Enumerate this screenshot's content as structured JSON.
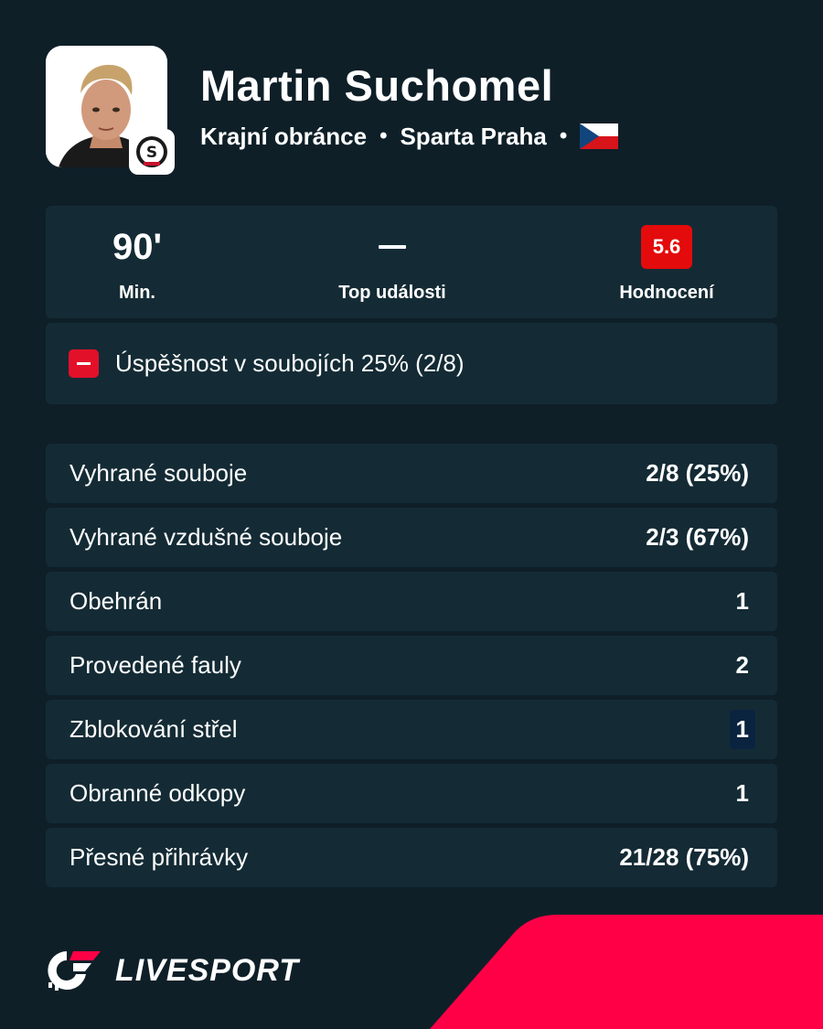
{
  "player": {
    "name": "Martin Suchomel",
    "position": "Krajní obránce",
    "team": "Sparta Praha",
    "separator": "•",
    "club_badge_letter": "S"
  },
  "summary": {
    "minutes_value": "90'",
    "minutes_label": "Min.",
    "top_events_label": "Top události",
    "rating_value": "5.6",
    "rating_label": "Hodnocení"
  },
  "event": {
    "text": "Úspěšnost v soubojích 25% (2/8)"
  },
  "stats": [
    {
      "label": "Vyhrané souboje",
      "value": "2/8 (25%)"
    },
    {
      "label": "Vyhrané vzdušné souboje",
      "value": "2/3 (67%)"
    },
    {
      "label": "Obehrán",
      "value": "1"
    },
    {
      "label": "Provedené fauly",
      "value": "2"
    },
    {
      "label": "Zblokování střel",
      "value": "1"
    },
    {
      "label": "Obranné odkopy",
      "value": "1"
    },
    {
      "label": "Přesné přihrávky",
      "value": "21/28 (75%)"
    }
  ],
  "brand": {
    "name": "LIVESPORT"
  },
  "colors": {
    "background": "#0e1f28",
    "card": "#142b35",
    "accent_red": "#ff0046",
    "rating_red": "#e30b0b"
  }
}
